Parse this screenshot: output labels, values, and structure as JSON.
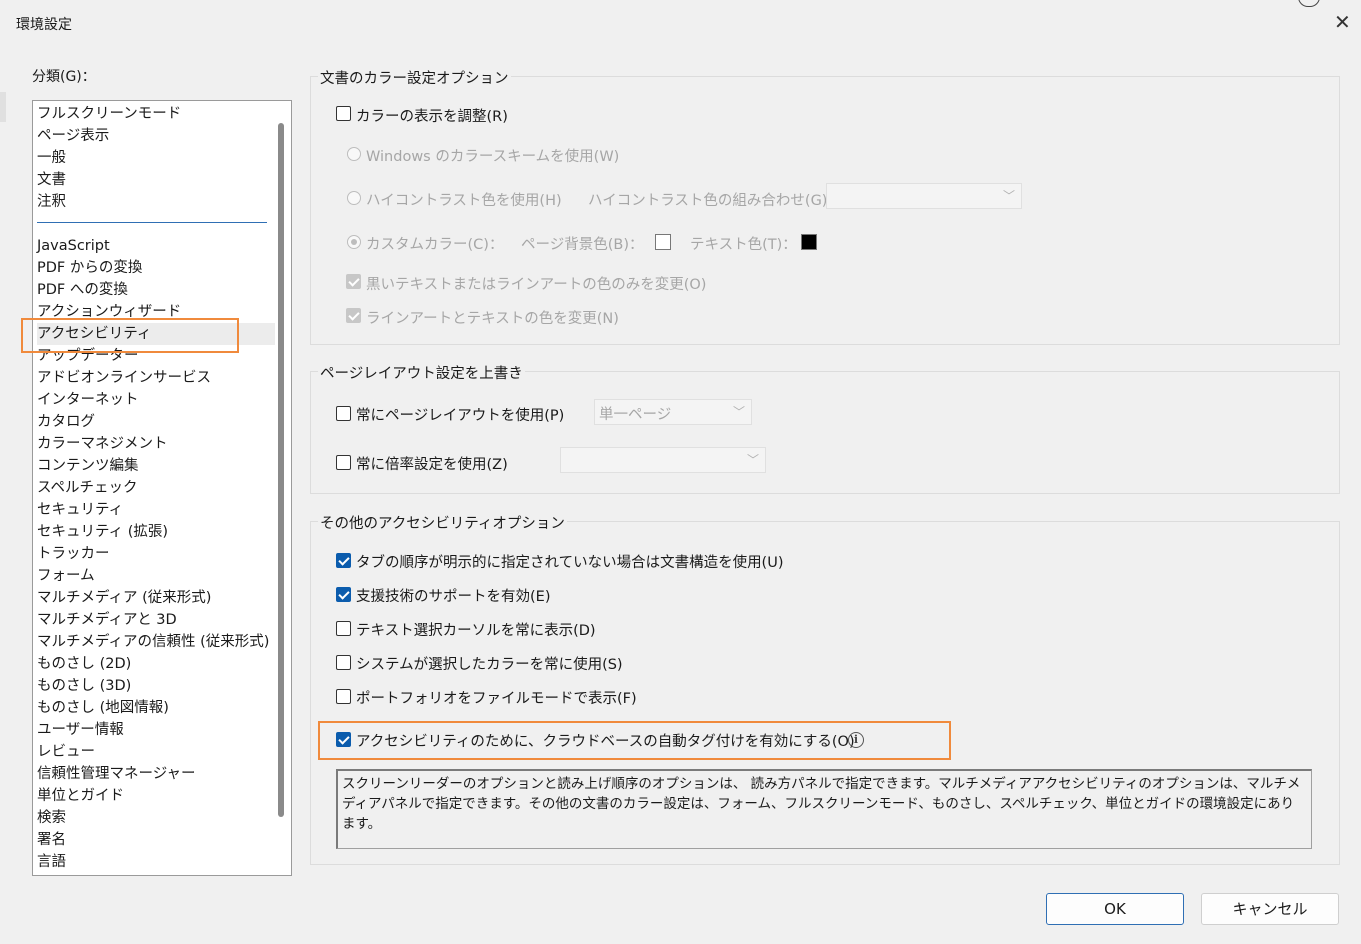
{
  "window": {
    "title": "環境設定",
    "close_glyph": "✕"
  },
  "categories": {
    "label": "分類(G)：",
    "group1": [
      "フルスクリーンモード",
      "ページ表示",
      "一般",
      "文書",
      "注釈"
    ],
    "group2": [
      "JavaScript",
      "PDF からの変換",
      "PDF への変換",
      "アクションウィザード",
      "アクセシビリティ",
      "アップデーター",
      "アドビオンラインサービス",
      "インターネット",
      "カタログ",
      "カラーマネジメント",
      "コンテンツ編集",
      "スペルチェック",
      "セキュリティ",
      "セキュリティ (拡張)",
      "トラッカー",
      "フォーム",
      "マルチメディア (従来形式)",
      "マルチメディアと 3D",
      "マルチメディアの信頼性 (従来形式)",
      "ものさし (2D)",
      "ものさし (3D)",
      "ものさし (地図情報)",
      "ユーザー情報",
      "レビュー",
      "信頼性管理マネージャー",
      "単位とガイド",
      "検索",
      "署名",
      "言語"
    ],
    "selected": "アクセシビリティ"
  },
  "color_options": {
    "title": "文書のカラー設定オプション",
    "adjust_colors": {
      "label": "カラーの表示を調整(R)",
      "checked": false
    },
    "use_windows_scheme": {
      "label": "Windows のカラースキームを使用(W)",
      "selected": false
    },
    "use_high_contrast": {
      "label": "ハイコントラスト色を使用(H)",
      "selected": false
    },
    "high_contrast_combo_label": "ハイコントラスト色の組み合わせ(G)：",
    "high_contrast_combo_value": "",
    "custom_color": {
      "label": "カスタムカラー(C)：",
      "selected": true
    },
    "page_bg_label": "ページ背景色(B)：",
    "page_bg_color": "#ffffff",
    "text_color_label": "テキスト色(T)：",
    "text_color": "#000000",
    "only_black_text": {
      "label": "黒いテキストまたはラインアートの色のみを変更(O)",
      "checked": true
    },
    "change_line_art": {
      "label": "ラインアートとテキストの色を変更(N)",
      "checked": true
    }
  },
  "layout_override": {
    "title": "ページレイアウト設定を上書き",
    "always_layout": {
      "label": "常にページレイアウトを使用(P)",
      "checked": false
    },
    "layout_value": "単一ページ",
    "always_zoom": {
      "label": "常に倍率設定を使用(Z)",
      "checked": false
    },
    "zoom_value": ""
  },
  "other_options": {
    "title": "その他のアクセシビリティオプション",
    "items": [
      {
        "label": "タブの順序が明示的に指定されていない場合は文書構造を使用(U)",
        "checked": true
      },
      {
        "label": "支援技術のサポートを有効(E)",
        "checked": true
      },
      {
        "label": "テキスト選択カーソルを常に表示(D)",
        "checked": false
      },
      {
        "label": "システムが選択したカラーを常に使用(S)",
        "checked": false
      },
      {
        "label": "ポートフォリオをファイルモードで表示(F)",
        "checked": false
      }
    ],
    "cloud_autotag": {
      "label": "アクセシビリティのために、クラウドベースの自動タグ付けを有効にする(O)",
      "checked": true
    },
    "info_glyph": "i"
  },
  "description": "スクリーンリーダーのオプションと読み上げ順序のオプションは、 読み方パネルで指定できます。マルチメディアアクセシビリティのオプションは、マルチメディアパネルで指定できます。その他の文書のカラー設定は、フォーム、フルスクリーンモード、ものさし、スペルチェック、単位とガイドの環境設定にあります。",
  "buttons": {
    "ok": "OK",
    "cancel": "キャンセル"
  },
  "colors": {
    "accent": "#0b5cad",
    "highlight": "#f08a3c",
    "separator": "#2f6fb4"
  },
  "icons": [
    "close-icon",
    "info-icon",
    "chevron-down-icon",
    "checkbox-checked-icon"
  ]
}
